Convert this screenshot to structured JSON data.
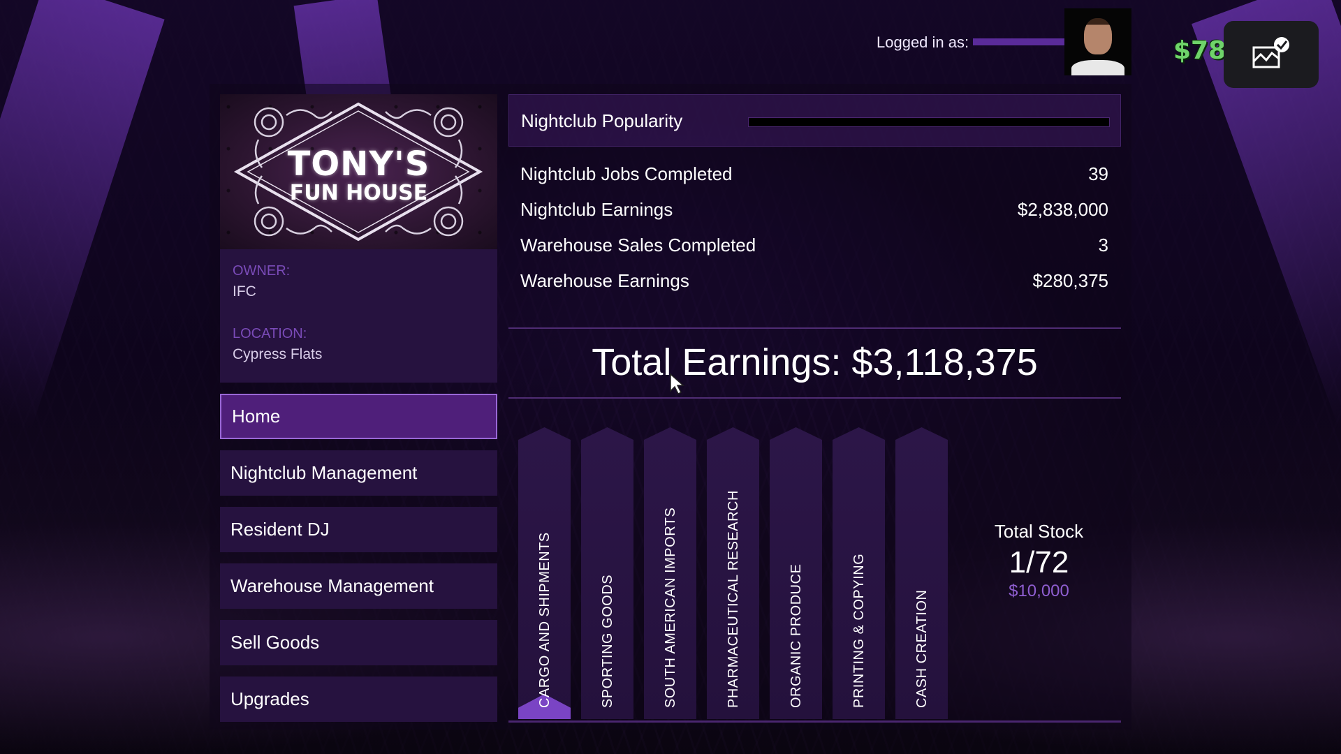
{
  "hud": {
    "logged_in_label": "Logged in as:",
    "cash": "$78",
    "notification_icon": "image-check-icon",
    "avatar": "player-portrait"
  },
  "club": {
    "logo_line1": "TONY'S",
    "logo_line2": "FUN HOUSE",
    "owner_label": "OWNER:",
    "owner_value": "IFC",
    "location_label": "LOCATION:",
    "location_value": "Cypress Flats"
  },
  "nav": {
    "items": [
      {
        "label": "Home",
        "active": true
      },
      {
        "label": "Nightclub Management",
        "active": false
      },
      {
        "label": "Resident DJ",
        "active": false
      },
      {
        "label": "Warehouse Management",
        "active": false
      },
      {
        "label": "Sell Goods",
        "active": false
      },
      {
        "label": "Upgrades",
        "active": false
      }
    ]
  },
  "popularity": {
    "label": "Nightclub Popularity",
    "value_percent": 0
  },
  "stats": [
    {
      "label": "Nightclub Jobs Completed",
      "value": "39"
    },
    {
      "label": "Nightclub Earnings",
      "value": "$2,838,000"
    },
    {
      "label": "Warehouse Sales Completed",
      "value": "3"
    },
    {
      "label": "Warehouse Earnings",
      "value": "$280,375"
    }
  ],
  "total_earnings": "Total Earnings: $3,118,375",
  "goods": [
    {
      "label": "CARGO AND SHIPMENTS",
      "stock_level": 1
    },
    {
      "label": "SPORTING GOODS",
      "stock_level": 0
    },
    {
      "label": "SOUTH AMERICAN IMPORTS",
      "stock_level": 0
    },
    {
      "label": "PHARMACEUTICAL RESEARCH",
      "stock_level": 0
    },
    {
      "label": "ORGANIC PRODUCE",
      "stock_level": 0
    },
    {
      "label": "PRINTING & COPYING",
      "stock_level": 0
    },
    {
      "label": "CASH CREATION",
      "stock_level": 0
    }
  ],
  "total_stock": {
    "label": "Total Stock",
    "count": "1/72",
    "value": "$10,000"
  },
  "colors": {
    "accent": "#7a44c4",
    "panel": "#26123f",
    "active_nav": "#4f1f7a",
    "cash_green": "#6fd46a",
    "stock_value": "#8f5ed0"
  }
}
